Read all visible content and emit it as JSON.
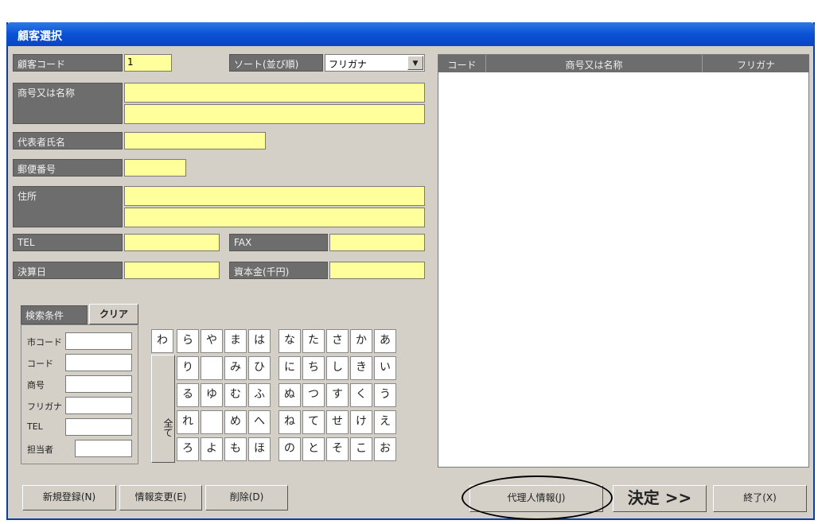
{
  "window": {
    "title": "顧客選択"
  },
  "form": {
    "customer_code_label": "顧客コード",
    "customer_code_value": "1",
    "sort_label": "ソート(並び順)",
    "sort_value": "フリガナ",
    "name_label": "商号又は名称",
    "representative_label": "代表者氏名",
    "postal_label": "郵便番号",
    "address_label": "住所",
    "tel_label": "TEL",
    "fax_label": "FAX",
    "settlement_label": "決算日",
    "capital_label": "資本金(千円)"
  },
  "list": {
    "headers": [
      "コード",
      "商号又は名称",
      "フリガナ"
    ]
  },
  "search": {
    "title": "検索条件",
    "clear": "クリア",
    "fields": [
      "市コード",
      "コード",
      "商号",
      "フリガナ",
      "TEL",
      "担当者"
    ],
    "all_label": "全て"
  },
  "kana": {
    "row1": [
      "わ",
      "ら",
      "や",
      "ま",
      "は",
      "な",
      "た",
      "さ",
      "か",
      "あ"
    ],
    "row2": [
      "",
      "り",
      "",
      "み",
      "ひ",
      "に",
      "ち",
      "し",
      "き",
      "い"
    ],
    "row3": [
      "",
      "る",
      "ゆ",
      "む",
      "ふ",
      "ぬ",
      "つ",
      "す",
      "く",
      "う"
    ],
    "row4": [
      "",
      "れ",
      "",
      "め",
      "へ",
      "ね",
      "て",
      "せ",
      "け",
      "え"
    ],
    "row5": [
      "",
      "ろ",
      "よ",
      "も",
      "ほ",
      "の",
      "と",
      "そ",
      "こ",
      "お"
    ]
  },
  "buttons": {
    "new": "新規登録(N)",
    "edit": "情報変更(E)",
    "delete": "削除(D)",
    "agent": "代理人情報(J)",
    "decide": "決定 >>",
    "exit": "終了(X)"
  }
}
